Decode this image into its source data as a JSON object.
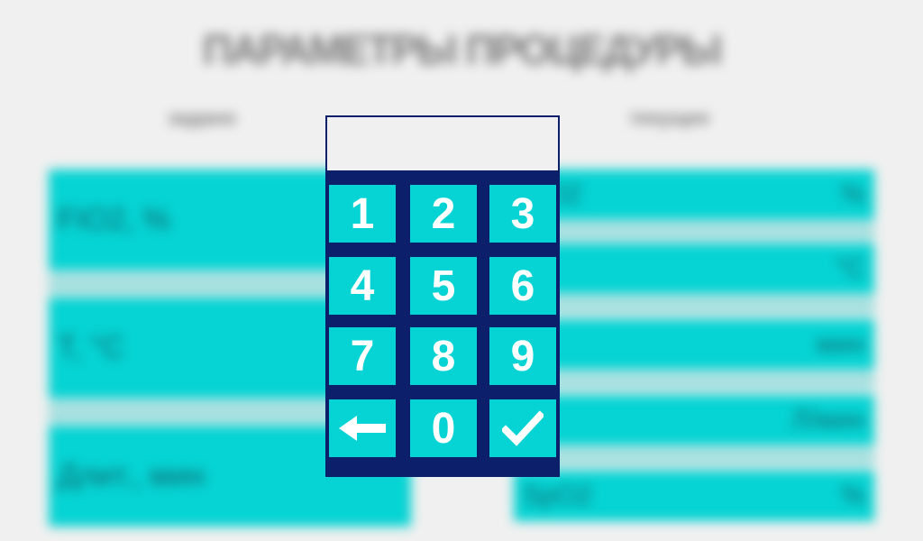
{
  "screen": {
    "title": "ПАРАМЕТРЫ ПРОЦЕДУРЫ",
    "left_column_header": "задано",
    "right_column_header": "текущее"
  },
  "left_params": [
    {
      "label": "FIO2, %"
    },
    {
      "label": "T, °C"
    },
    {
      "label": "Длит., мин"
    }
  ],
  "right_params": [
    {
      "label": "FiO2",
      "unit": "%"
    },
    {
      "label": "",
      "unit": "°C"
    },
    {
      "label": "",
      "unit": "мин"
    },
    {
      "label": "",
      "unit": "Л/мин"
    },
    {
      "label": "SpO2",
      "unit": "%"
    }
  ],
  "keypad": {
    "display_value": "",
    "keys": [
      "1",
      "2",
      "3",
      "4",
      "5",
      "6",
      "7",
      "8",
      "9",
      "",
      "0",
      ""
    ],
    "backspace_icon": "left-arrow-icon",
    "confirm_icon": "checkmark-icon"
  },
  "colors": {
    "background": "#f0f0f0",
    "row_fill": "#06d3d3",
    "row_separator": "#a7dfdf",
    "keypad_frame": "#0b1f6b",
    "key_fill": "#06d3d3",
    "key_text": "#ffffff"
  }
}
